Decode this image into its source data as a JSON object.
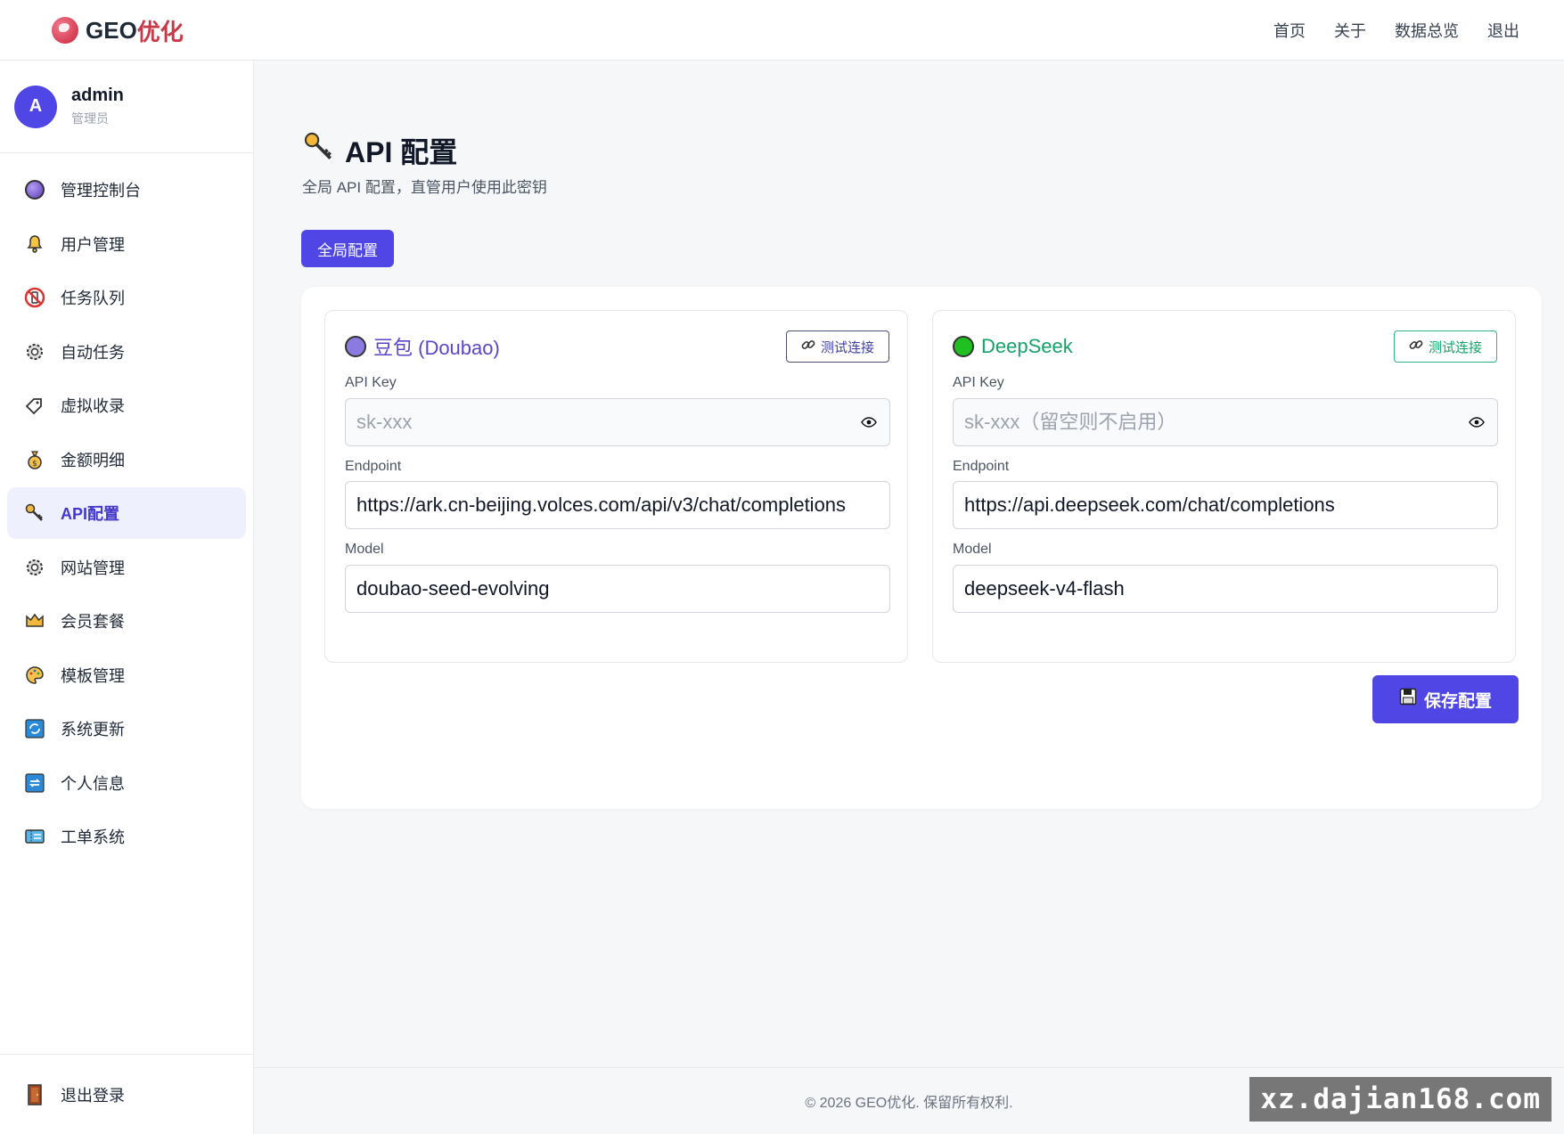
{
  "brand": {
    "prefix": "GEO",
    "suffix": "优化"
  },
  "topnav": [
    "首页",
    "关于",
    "数据总览",
    "退出"
  ],
  "user": {
    "initial": "A",
    "name": "admin",
    "role": "管理员"
  },
  "menu": [
    {
      "label": "管理控制台",
      "icon": "crystal-ball-icon"
    },
    {
      "label": "用户管理",
      "icon": "bell-icon"
    },
    {
      "label": "任务队列",
      "icon": "no-phone-icon"
    },
    {
      "label": "自动任务",
      "icon": "gear-icon"
    },
    {
      "label": "虚拟收录",
      "icon": "tag-icon"
    },
    {
      "label": "金额明细",
      "icon": "money-bag-icon"
    },
    {
      "label": "API配置",
      "icon": "key-icon",
      "active": true
    },
    {
      "label": "网站管理",
      "icon": "gear-icon"
    },
    {
      "label": "会员套餐",
      "icon": "crown-icon"
    },
    {
      "label": "模板管理",
      "icon": "palette-icon"
    },
    {
      "label": "系统更新",
      "icon": "refresh-icon"
    },
    {
      "label": "个人信息",
      "icon": "repeat-icon"
    },
    {
      "label": "工单系统",
      "icon": "ticket-icon"
    }
  ],
  "logout_label": "退出登录",
  "page": {
    "title": "API 配置",
    "subtitle": "全局 API 配置，直管用户使用此密钥",
    "tab_label": "全局配置",
    "save_label": "保存配置"
  },
  "providers": [
    {
      "name": "豆包 (Doubao)",
      "color": "#5b46c8",
      "dot_color": "#8b7be0",
      "test_label": "测试连接",
      "api_key_label": "API Key",
      "api_key_placeholder": "sk-xxx",
      "endpoint_label": "Endpoint",
      "endpoint": "https://ark.cn-beijing.volces.com/api/v3/chat/completions",
      "model_label": "Model",
      "model": "doubao-seed-evolving"
    },
    {
      "name": "DeepSeek",
      "color": "#16a36a",
      "dot_color": "#1fc01f",
      "test_label": "测试连接",
      "api_key_label": "API Key",
      "api_key_placeholder": "sk-xxx（留空则不启用）",
      "endpoint_label": "Endpoint",
      "endpoint": "https://api.deepseek.com/chat/completions",
      "model_label": "Model",
      "model": "deepseek-v4-flash"
    }
  ],
  "footer": "© 2026 GEO优化. 保留所有权利.",
  "watermark": "xz.dajian168.com"
}
